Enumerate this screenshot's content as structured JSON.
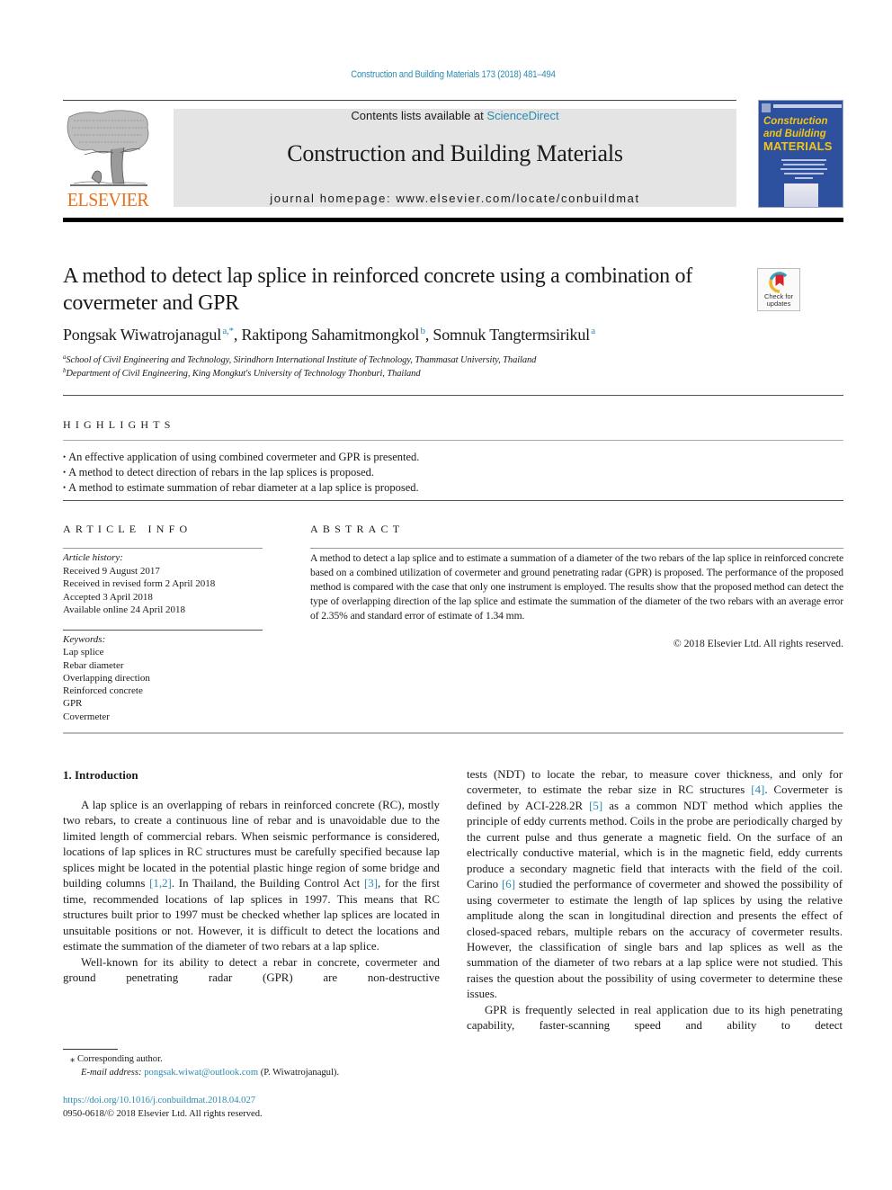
{
  "running_header": "Construction and Building Materials 173 (2018) 481–494",
  "publisher": {
    "name": "ELSEVIER",
    "brand_color": "#e9711c"
  },
  "banner": {
    "contents_prefix": "Contents lists available at ",
    "contents_link": "ScienceDirect",
    "journal_title": "Construction and Building Materials",
    "homepage_prefix": "journal homepage: ",
    "homepage_url": "www.elsevier.com/locate/conbuildmat"
  },
  "cover": {
    "line1": "Construction",
    "line2": "and Building",
    "line3": "MATERIALS",
    "background_color": "#2c4f9e",
    "title_color": "#f3c41a"
  },
  "article": {
    "title": "A method to detect lap splice in reinforced concrete using a combination of covermeter and GPR",
    "crossmark_label_1": "Check for",
    "crossmark_label_2": "updates",
    "authors": [
      {
        "name": "Pongsak Wiwatrojanagul",
        "sup": "a,*"
      },
      {
        "name": "Raktipong Sahamitmongkol",
        "sup": "b"
      },
      {
        "name": "Somnuk Tangtermsirikul",
        "sup": "a"
      }
    ],
    "affiliations": [
      {
        "mark": "a",
        "text": "School of Civil Engineering and Technology, Sirindhorn International Institute of Technology, Thammasat University, Thailand"
      },
      {
        "mark": "b",
        "text": "Department of Civil Engineering, King Mongkut's University of Technology Thonburi, Thailand"
      }
    ]
  },
  "highlights": {
    "heading": "HIGHLIGHTS",
    "items": [
      "An effective application of using combined covermeter and GPR is presented.",
      "A method to detect direction of rebars in the lap splices is proposed.",
      "A method to estimate summation of rebar diameter at a lap splice is proposed."
    ]
  },
  "article_info": {
    "heading": "ARTICLE INFO",
    "history_label": "Article history:",
    "history": [
      "Received 9 August 2017",
      "Received in revised form 2 April 2018",
      "Accepted 3 April 2018",
      "Available online 24 April 2018"
    ],
    "keywords_label": "Keywords:",
    "keywords": [
      "Lap splice",
      "Rebar diameter",
      "Overlapping direction",
      "Reinforced concrete",
      "GPR",
      "Covermeter"
    ]
  },
  "abstract": {
    "heading": "ABSTRACT",
    "text": "A method to detect a lap splice and to estimate a summation of a diameter of the two rebars of the lap splice in reinforced concrete based on a combined utilization of covermeter and ground penetrating radar (GPR) is proposed. The performance of the proposed method is compared with the case that only one instrument is employed. The results show that the proposed method can detect the type of overlapping direction of the lap splice and estimate the summation of the diameter of the two rebars with an average error of 2.35% and standard error of estimate of 1.34 mm.",
    "copyright": "© 2018 Elsevier Ltd. All rights reserved."
  },
  "body": {
    "section_heading": "1. Introduction",
    "left": {
      "p1_a": "A lap splice is an overlapping of rebars in reinforced concrete (RC), mostly two rebars, to create a continuous line of rebar and is unavoidable due to the limited length of commercial rebars. When seismic performance is considered, locations of lap splices in RC structures must be carefully specified because lap splices might be located in the potential plastic hinge region of some bridge and building columns ",
      "ref_1_2": "[1,2]",
      "p1_b": ". In Thailand, the Building Control Act ",
      "ref_3": "[3]",
      "p1_c": ", for the first time, recommended locations of lap splices in 1997. This means that RC structures built prior to 1997 must be checked whether lap splices are located in unsuitable positions or not. However, it is difficult to detect the locations and estimate the summation of the diameter of two rebars at a lap splice.",
      "p2": "Well-known for its ability to detect a rebar in concrete, covermeter and ground penetrating radar (GPR) are non-destructive"
    },
    "right": {
      "p1_a": "tests (NDT) to locate the rebar, to measure cover thickness, and only for covermeter, to estimate the rebar size in RC structures ",
      "ref_4": "[4]",
      "p1_b": ". Covermeter is defined by ACI-228.2R ",
      "ref_5": "[5]",
      "p1_c": " as a common NDT method which applies the principle of eddy currents method. Coils in the probe are periodically charged by the current pulse and thus generate a magnetic field. On the surface of an electrically conductive material, which is in the magnetic field, eddy currents produce a secondary magnetic field that interacts with the field of the coil. Carino ",
      "ref_6": "[6]",
      "p1_d": " studied the performance of covermeter and showed the possibility of using covermeter to estimate the length of lap splices by using the relative amplitude along the scan in longitudinal direction and presents the effect of closed-spaced rebars, multiple rebars on the accuracy of covermeter results. However, the classification of single bars and lap splices as well as the summation of the diameter of two rebars at a lap splice were not studied. This raises the question about the possibility of using covermeter to determine these issues.",
      "p2": "GPR is frequently selected in real application due to its high penetrating capability, faster-scanning speed and ability to detect"
    }
  },
  "footnote": {
    "star": "⁎",
    "corresponding": "Corresponding author.",
    "email_label": "E-mail address:",
    "email": "pongsak.wiwat@outlook.com",
    "email_suffix": " (P. Wiwatrojanagul)."
  },
  "doi": {
    "url": "https://doi.org/10.1016/j.conbuildmat.2018.04.027",
    "issn_line": "0950-0618/© 2018 Elsevier Ltd. All rights reserved."
  },
  "colors": {
    "link": "#2a8ab0",
    "banner_bg": "#e4e4e4"
  }
}
